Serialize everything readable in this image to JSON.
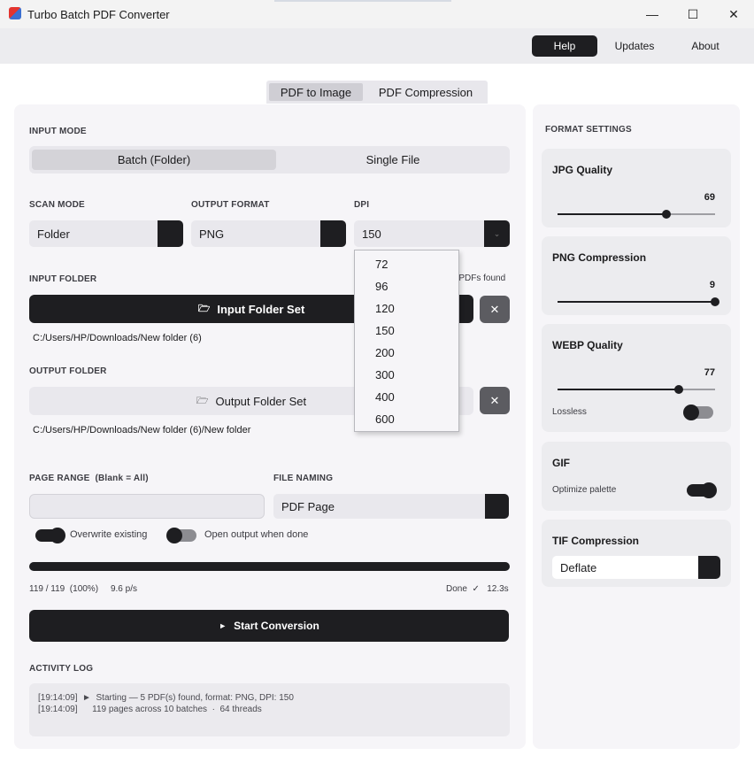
{
  "window": {
    "title": "Turbo Batch PDF Converter",
    "controls": {
      "minimize": "—",
      "maximize": "☐",
      "close": "✕"
    }
  },
  "menu": {
    "help": "Help",
    "updates": "Updates",
    "about": "About"
  },
  "tabs": {
    "pdf_to_image": "PDF to Image",
    "pdf_compression": "PDF Compression"
  },
  "input_mode": {
    "label": "INPUT MODE",
    "options": [
      "Batch (Folder)",
      "Single File"
    ],
    "selected": "Batch (Folder)"
  },
  "scan_mode": {
    "label": "SCAN MODE",
    "value": "Folder"
  },
  "output_format": {
    "label": "OUTPUT FORMAT",
    "value": "PNG"
  },
  "dpi": {
    "label": "DPI",
    "value": "150",
    "options": [
      "72",
      "96",
      "120",
      "150",
      "200",
      "300",
      "400",
      "600"
    ]
  },
  "input_folder": {
    "label": "INPUT FOLDER",
    "found_text": "5 PDFs found",
    "button": "Input Folder Set",
    "clear": "✕",
    "path": "C:/Users/HP/Downloads/New folder (6)"
  },
  "output_folder": {
    "label": "OUTPUT FOLDER",
    "button": "Output Folder Set",
    "clear": "✕",
    "path": "C:/Users/HP/Downloads/New folder (6)/New folder"
  },
  "page_range": {
    "label": "PAGE RANGE",
    "hint": "(Blank = All)",
    "value": ""
  },
  "file_naming": {
    "label": "FILE NAMING",
    "value": "PDF Page"
  },
  "toggles": {
    "overwrite": {
      "label": "Overwrite existing",
      "on": true
    },
    "open_output": {
      "label": "Open output when done",
      "on": false
    }
  },
  "progress": {
    "fraction": 1.0,
    "count": "119 / 119",
    "percent": "(100%)",
    "rate": "9.6 p/s",
    "status": "Done",
    "check": "✓",
    "elapsed": "12.3s"
  },
  "start_button": {
    "icon": "►",
    "label": "Start Conversion"
  },
  "activity_log": {
    "label": "ACTIVITY LOG",
    "lines": [
      "[19:14:09]  ►  Starting — 5 PDF(s) found, format: PNG, DPI: 150",
      "[19:14:09]      119 pages across 10 batches  ·  64 threads"
    ]
  },
  "format_settings": {
    "label": "FORMAT SETTINGS",
    "jpg": {
      "title": "JPG Quality",
      "value": "69",
      "fraction": 0.69
    },
    "png": {
      "title": "PNG Compression",
      "value": "9",
      "fraction": 1.0
    },
    "webp": {
      "title": "WEBP Quality",
      "value": "77",
      "fraction": 0.77,
      "lossless_label": "Lossless",
      "lossless_on": false
    },
    "gif": {
      "title": "GIF",
      "optimize_label": "Optimize palette",
      "optimize_on": true
    },
    "tif": {
      "title": "TIF Compression",
      "value": "Deflate"
    }
  },
  "colors": {
    "accent_dark": "#1e1e21",
    "panel_bg": "#f6f5f8",
    "card_bg": "#ececef"
  }
}
